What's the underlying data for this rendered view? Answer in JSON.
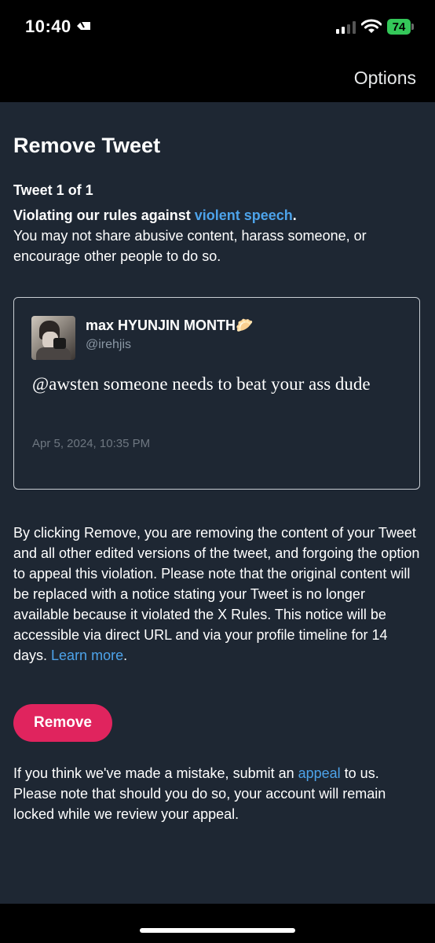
{
  "status_bar": {
    "time": "10:40",
    "battery": "74"
  },
  "nav": {
    "options_label": "Options"
  },
  "page": {
    "title": "Remove Tweet",
    "tweet_count": "Tweet 1 of 1",
    "violation_prefix": "Violating our rules against ",
    "violation_link": "violent speech",
    "violation_suffix": ".",
    "violation_body": "You may not share abusive content, harass someone, or encourage other people to do so."
  },
  "tweet": {
    "display_name": "max HYUNJIN MONTH",
    "name_emoji": "🥟",
    "handle": "@irehjis",
    "text": "@awsten someone needs to beat your ass dude",
    "date": "Apr 5, 2024, 10:35 PM"
  },
  "disclaimer": {
    "text": "By clicking Remove, you are removing the content of your Tweet and all other edited versions of the tweet, and forgoing the option to appeal this violation. Please note that the original content will be replaced with a notice stating your Tweet is no longer available because it violated the X Rules. This notice will be accessible via direct URL and via your profile timeline for 14 days. ",
    "link": "Learn more",
    "suffix": "."
  },
  "remove_button": {
    "label": "Remove",
    "color": "#e0245e"
  },
  "appeal": {
    "prefix": "If you think we've made a mistake, submit an ",
    "link": "appeal",
    "suffix": " to us. Please note that should you do so, your account will remain locked while we review your appeal."
  },
  "colors": {
    "background": "#1e2733",
    "link": "#4da3ea"
  }
}
